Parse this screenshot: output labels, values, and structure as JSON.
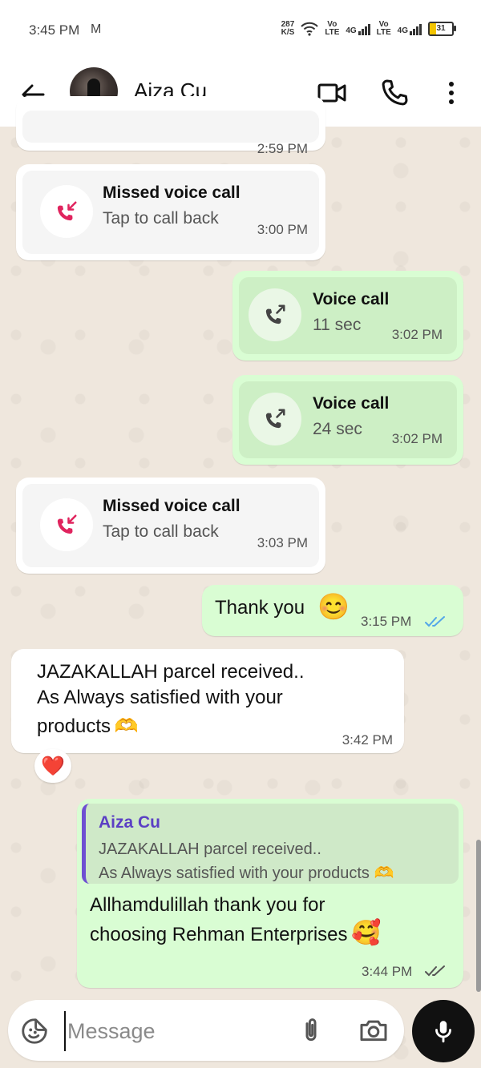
{
  "status_bar": {
    "time": "3:45 PM",
    "mail_icon": "M",
    "speed_value": "287",
    "speed_unit": "K/S",
    "volte1": "Vo LTE",
    "net1": "4G",
    "volte2": "Vo LTE",
    "net2": "4G",
    "battery": "31"
  },
  "header": {
    "contact_name": "Aiza Cu"
  },
  "messages": [
    {
      "title": "Missed voice call",
      "subtitle": "Tap to call back",
      "time": "3:00 PM"
    },
    {
      "title": "Voice call",
      "subtitle": "11 sec",
      "time": "3:02 PM"
    },
    {
      "title": "Voice call",
      "subtitle": "24 sec",
      "time": "3:02 PM"
    },
    {
      "title": "Missed voice call",
      "subtitle": "Tap to call back",
      "time": "3:03 PM"
    },
    {
      "text": "Thank you",
      "emoji": "😊",
      "time": "3:15 PM"
    },
    {
      "line1": "JAZAKALLAH parcel received..",
      "line2": "As Always satisfied with your",
      "line3": "products",
      "emoji": "🫶",
      "time": "3:42 PM",
      "reaction": "❤️"
    },
    {
      "quote_name": "Aiza Cu",
      "quote_line1": "JAZAKALLAH parcel received..",
      "quote_line2": "As Always satisfied with your products",
      "quote_emoji": "🫶",
      "line1": "Allhamdulillah thank you for",
      "line2": "choosing Rehman Enterprises",
      "emoji": "🥰",
      "time": "3:44 PM"
    }
  ],
  "partial_top_time": "2:59 PM",
  "input": {
    "placeholder": "Message"
  },
  "colors": {
    "incoming_bubble": "#ffffff",
    "outgoing_bubble": "#d9fdd3",
    "missed_call_red": "#e0245e",
    "read_ticks_blue": "#53a6e8",
    "quote_bar": "#6e4fd2"
  },
  "icons": [
    "back-arrow-icon",
    "video-call-icon",
    "phone-icon",
    "more-vert-icon",
    "missed-call-icon",
    "outgoing-call-icon",
    "sticker-icon",
    "attach-icon",
    "camera-icon",
    "mic-icon"
  ]
}
